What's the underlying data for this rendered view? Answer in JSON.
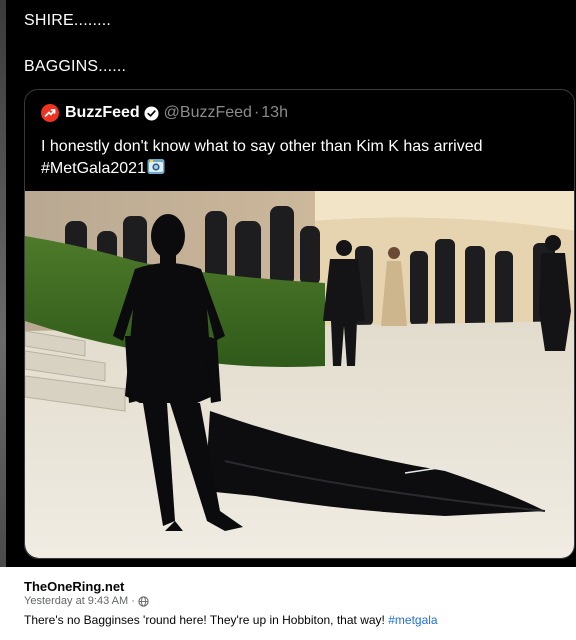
{
  "tweet": {
    "line1": "SHIRE........",
    "line2": "BAGGINS......"
  },
  "quoted": {
    "name": "BuzzFeed",
    "handle": "@BuzzFeed",
    "separator": "·",
    "time": "13h",
    "text": "I honestly don't know what to say other than Kim K has arrived",
    "hashtag": "#MetGala2021",
    "logo_icon": "buzzfeed-trend-icon",
    "verified_icon": "verified-badge-icon",
    "emoji_icon": "camera-with-flash-icon"
  },
  "facebook": {
    "page_name": "TheOneRing.net",
    "timestamp": "Yesterday at 9:43 AM ·",
    "audience_icon": "globe-icon",
    "post_text": "There's no Bagginses 'round here! They're up in Hobbiton, that way!",
    "post_hashtag": "#metgala"
  },
  "colors": {
    "tweet_bg": "#000000",
    "buzzfeed_red": "#ee3322",
    "muted_text": "#8b8b8b",
    "link_blue": "#216fdb"
  }
}
